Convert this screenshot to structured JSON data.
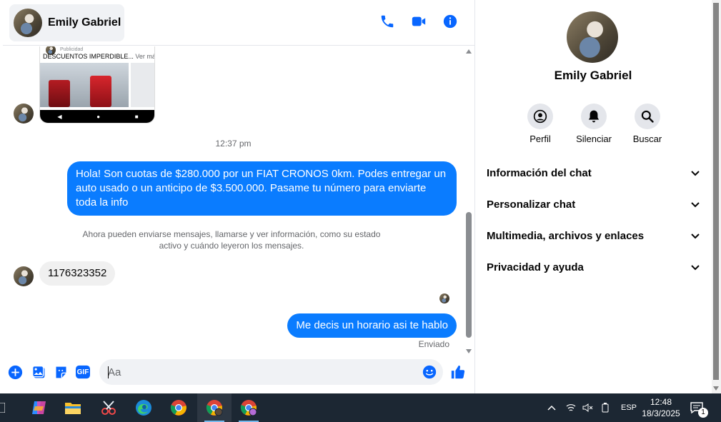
{
  "header": {
    "contact_name": "Emily Gabriel"
  },
  "ad": {
    "sponsored": "Publicidad",
    "title": "DESCUENTOS IMPERDIBLE...",
    "see_more": "Ver más"
  },
  "messages": {
    "time_1": "12:37 pm",
    "out_1": "Hola! Son cuotas de $280.000 por un FIAT CRONOS 0km. Podes entregar un auto usado o un anticipo de $3.500.000. Pasame tu número para enviarte toda la info",
    "system_note": "Ahora pueden enviarse mensajes, llamarse y ver información, como su estado activo y cuándo leyeron los mensajes.",
    "in_1": "1176323352",
    "out_2": "Me decis un horario asi te hablo",
    "status": "Enviado"
  },
  "composer": {
    "placeholder": "Aa",
    "gif_label": "GIF"
  },
  "panel": {
    "name": "Emily Gabriel",
    "actions": [
      "Perfil",
      "Silenciar",
      "Buscar"
    ],
    "sections": [
      "Información del chat",
      "Personalizar chat",
      "Multimedia, archivos y enlaces",
      "Privacidad y ayuda"
    ]
  },
  "taskbar": {
    "language": "ESP",
    "time": "12:48",
    "date": "18/3/2025",
    "notifications": "1"
  },
  "colors": {
    "accent": "#0a7cff",
    "icon_blue": "#0866ff",
    "taskbar": "#1c2733"
  }
}
